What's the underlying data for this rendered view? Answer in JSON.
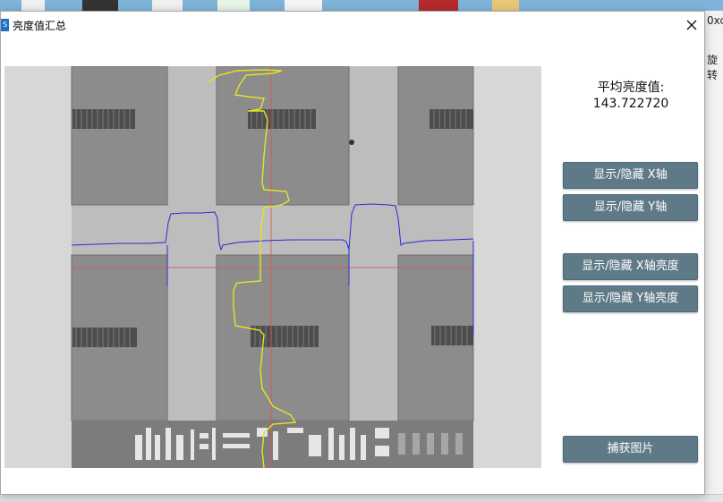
{
  "window": {
    "title": "亮度值汇总",
    "icon_text": "S"
  },
  "right_side_text": [
    "0xc",
    "旋转"
  ],
  "panel": {
    "avg_label": "平均亮度值:",
    "avg_value": "143.722720"
  },
  "buttons": {
    "toggle_x_axis": "显示/隐藏 X轴",
    "toggle_y_axis": "显示/隐藏 Y轴",
    "toggle_x_brightness": "显示/隐藏 X轴亮度",
    "toggle_y_brightness": "显示/隐藏 Y轴亮度",
    "capture": "捕获图片"
  },
  "colors": {
    "button_bg": "#5f7a87",
    "x_profile": "#2b2bd6",
    "y_profile": "#e5e521",
    "crosshair": "#e05050"
  }
}
